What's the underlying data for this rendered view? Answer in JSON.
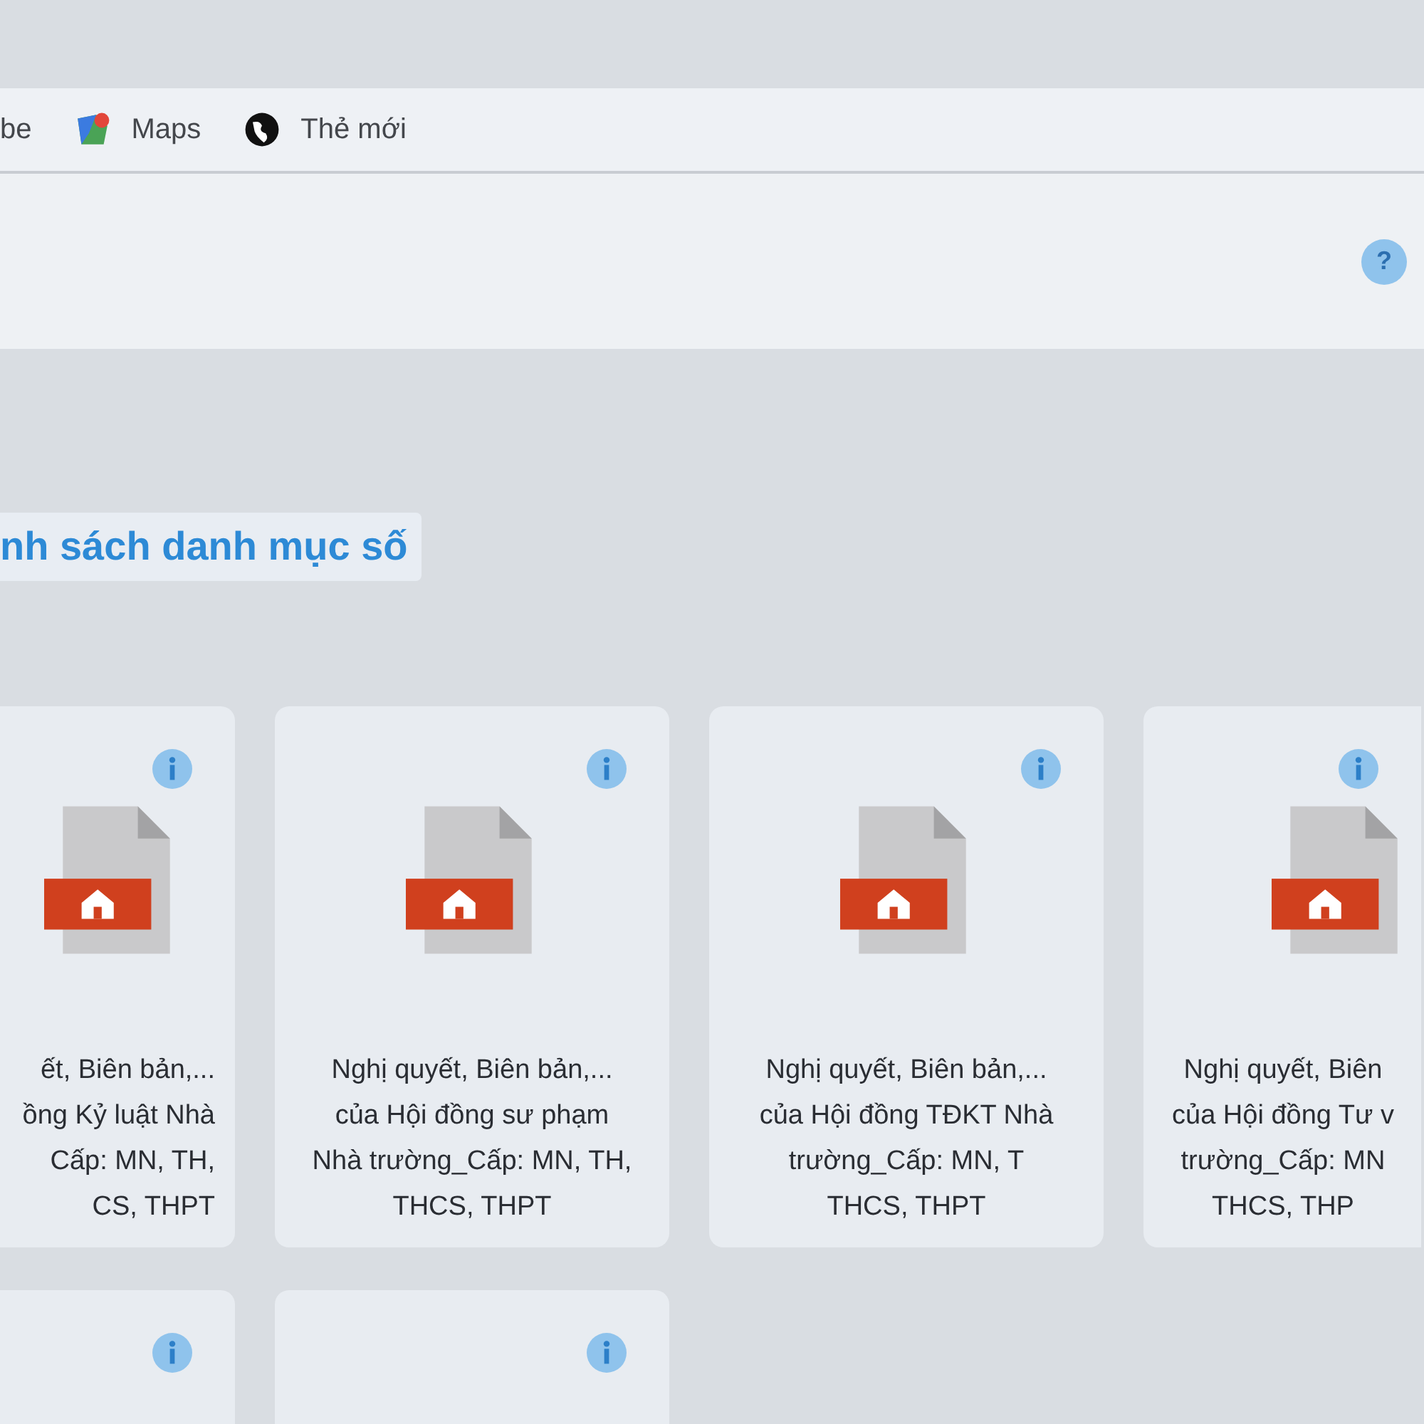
{
  "bookmarks": [
    {
      "label": "be"
    },
    {
      "label": "Maps"
    },
    {
      "label": "Thẻ mới"
    }
  ],
  "header": {
    "help": "?"
  },
  "section_title": "nh sách danh mục số",
  "cards": [
    {
      "lines": [
        "ết, Biên bản,...",
        "ồng Kỷ luật Nhà",
        "Cấp: MN, TH,",
        "CS, THPT"
      ]
    },
    {
      "lines": [
        "Nghị quyết, Biên bản,...",
        "của Hội đồng sư phạm",
        "Nhà trường_Cấp: MN, TH,",
        "THCS, THPT"
      ]
    },
    {
      "lines": [
        "Nghị quyết, Biên bản,...",
        "của Hội đồng TĐKT Nhà",
        "trường_Cấp: MN, T",
        "THCS, THPT"
      ]
    },
    {
      "lines": [
        "Nghị quyết, Biên",
        "của Hội đồng Tư v",
        "trường_Cấp: MN",
        "THCS, THP"
      ]
    }
  ]
}
